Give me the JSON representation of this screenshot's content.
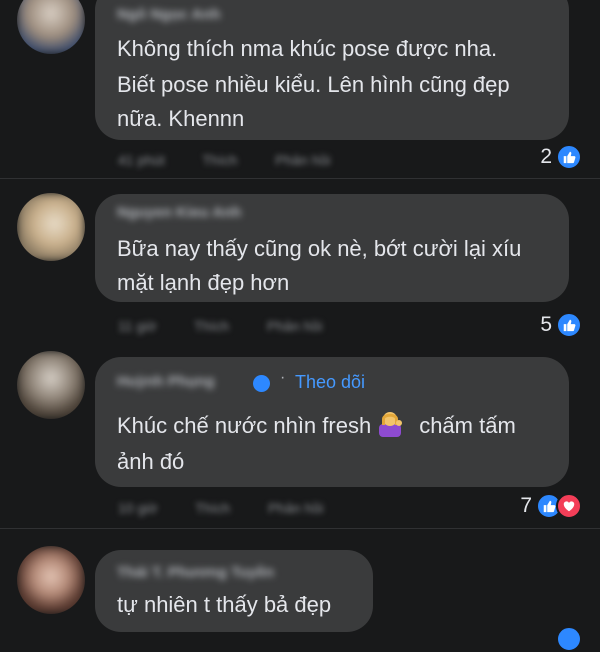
{
  "comments": [
    {
      "author": "Ngô Ngọc Anh",
      "lines": [
        "Không thích nma khúc pose được nha.",
        "Biết pose nhiều kiểu. Lên hình cũng đẹp",
        "nữa. Khennn"
      ],
      "time": "41 phút",
      "like_label": "Thích",
      "reply_label": "Phản hồi",
      "reaction_count": "2",
      "reactions": [
        "like-icon"
      ]
    },
    {
      "author": "Nguyen Kieu Anh",
      "lines": [
        "Bữa nay thấy cũng ok nè, bớt cười lại xíu",
        "mặt lạnh đẹp hơn"
      ],
      "time": "11 giờ",
      "like_label": "Thích",
      "reply_label": "Phản hồi",
      "reaction_count": "5",
      "reactions": [
        "like-icon"
      ]
    },
    {
      "author": "Huỳnh Phụng",
      "follow_label": "Theo dõi",
      "lines": [
        "Khúc chế nước nhìn fresh",
        "chấm tấm",
        "ảnh đó"
      ],
      "time": "10 giờ",
      "like_label": "Thích",
      "reply_label": "Phản hồi",
      "reaction_count": "7",
      "reactions": [
        "like-icon",
        "love-icon"
      ]
    },
    {
      "author": "Thái T. Phương Tuyền",
      "lines": [
        "tự nhiên t thấy bả đẹp"
      ]
    }
  ],
  "colors": {
    "background": "#18191a",
    "bubble": "#3a3b3c",
    "like": "#2d88ff",
    "love": "#f33e58",
    "follow": "#4599ff"
  }
}
